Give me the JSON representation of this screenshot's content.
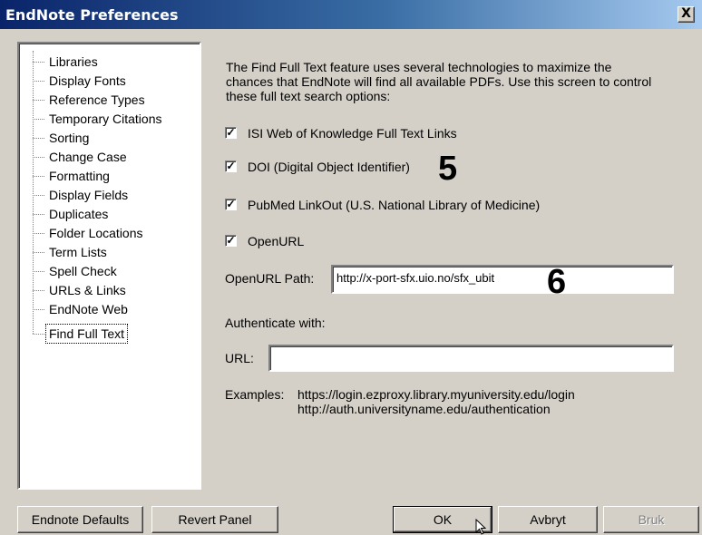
{
  "window": {
    "title": "EndNote Preferences",
    "close_glyph": "X"
  },
  "sidebar": {
    "items": [
      {
        "label": "Libraries"
      },
      {
        "label": "Display Fonts"
      },
      {
        "label": "Reference Types"
      },
      {
        "label": "Temporary Citations"
      },
      {
        "label": "Sorting"
      },
      {
        "label": "Change Case"
      },
      {
        "label": "Formatting"
      },
      {
        "label": "Display Fields"
      },
      {
        "label": "Duplicates"
      },
      {
        "label": "Folder Locations"
      },
      {
        "label": "Term Lists"
      },
      {
        "label": "Spell Check"
      },
      {
        "label": "URLs & Links"
      },
      {
        "label": "EndNote Web"
      },
      {
        "label": "Find Full Text"
      }
    ],
    "selected": "Find Full Text"
  },
  "panel": {
    "description": "The Find Full Text feature uses several technologies to maximize the chances that EndNote will find all available PDFs. Use this screen to control these full text search options:",
    "options": [
      {
        "label": "ISI Web of Knowledge Full Text Links",
        "checked": true
      },
      {
        "label": "DOI (Digital Object Identifier)",
        "checked": true
      },
      {
        "label": "PubMed LinkOut (U.S. National Library of Medicine)",
        "checked": true
      },
      {
        "label": "OpenURL",
        "checked": true
      }
    ],
    "check_glyph": "✓",
    "openurl_path_label": "OpenURL Path:",
    "openurl_path_value": "http://x-port-sfx.uio.no/sfx_ubit",
    "authenticate_label": "Authenticate with:",
    "url_label": "URL:",
    "url_value": "",
    "examples_label": "Examples:",
    "examples": [
      "https://login.ezproxy.library.myuniversity.edu/login",
      "http://auth.universityname.edu/authentication"
    ]
  },
  "annotations": {
    "num1": "5",
    "num2": "6"
  },
  "buttons": {
    "defaults": "Endnote Defaults",
    "revert": "Revert Panel",
    "ok": "OK",
    "cancel": "Avbryt",
    "apply": "Bruk"
  }
}
